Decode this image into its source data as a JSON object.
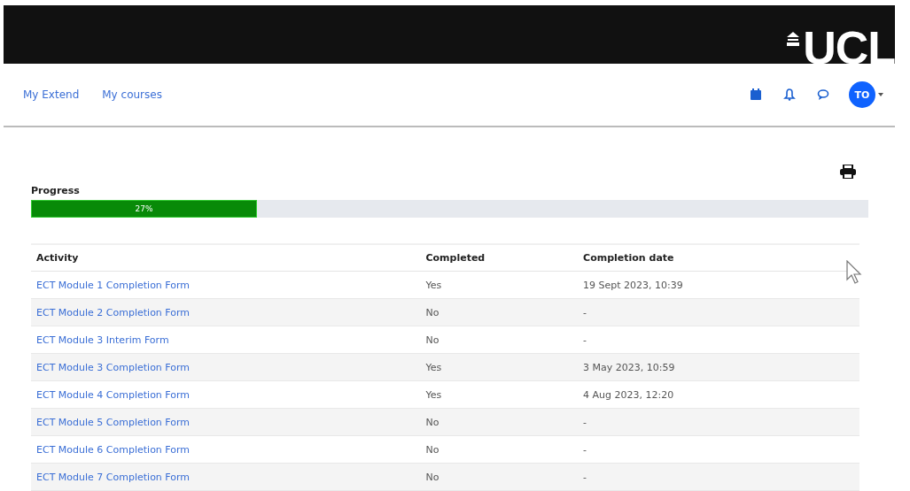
{
  "header": {
    "logo": "UCL"
  },
  "nav": {
    "links": [
      {
        "label": "My Extend"
      },
      {
        "label": "My courses"
      }
    ],
    "avatar": "TO"
  },
  "progress": {
    "label": "Progress",
    "level": 0.27,
    "reading": "27%"
  },
  "table": {
    "columns": [
      "Activity",
      "Completed",
      "Completion date"
    ],
    "rows": [
      {
        "activity": "ECT Module 1 Completion Form",
        "completed": "Yes",
        "date": "19 Sept 2023, 10:39"
      },
      {
        "activity": "ECT Module 2 Completion Form",
        "completed": "No",
        "date": "-"
      },
      {
        "activity": "ECT Module 3 Interim Form",
        "completed": "No",
        "date": "-"
      },
      {
        "activity": "ECT Module 3 Completion Form",
        "completed": "Yes",
        "date": "3 May 2023, 10:59"
      },
      {
        "activity": "ECT Module 4 Completion Form",
        "completed": "Yes",
        "date": "4 Aug 2023, 12:20"
      },
      {
        "activity": "ECT Module 5 Completion Form",
        "completed": "No",
        "date": "-"
      },
      {
        "activity": "ECT Module 6 Completion Form",
        "completed": "No",
        "date": "-"
      },
      {
        "activity": "ECT Module 7 Completion Form",
        "completed": "No",
        "date": "-"
      }
    ]
  }
}
